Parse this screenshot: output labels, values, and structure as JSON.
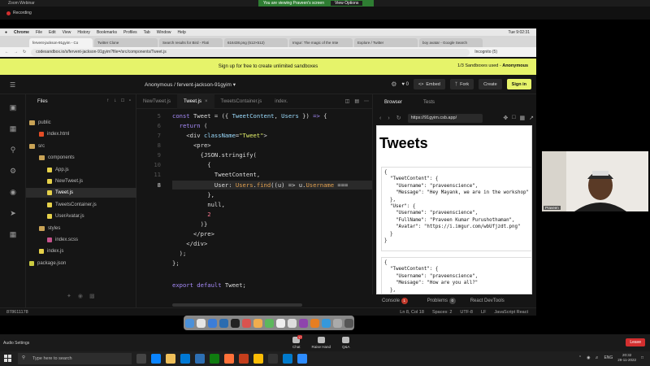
{
  "zoom": {
    "window_title": "Zoom Webinar",
    "banner_text": "You are viewing Praveen's screen",
    "view_options": "View Options",
    "recording": "Recording"
  },
  "mac_menu": {
    "items": [
      "Chrome",
      "File",
      "Edit",
      "View",
      "History",
      "Bookmarks",
      "Profiles",
      "Tab",
      "Window",
      "Help"
    ],
    "clock": "Tue 9:02:31"
  },
  "browser_tabs": [
    {
      "label": "fervent-jackson-91gyim - Co",
      "active": true
    },
    {
      "label": "Twitter Clone",
      "active": false
    },
    {
      "label": "Search results for Bird - Flati",
      "active": false
    },
    {
      "label": "616438.png (512×512)",
      "active": false
    },
    {
      "label": "Imgur: The magic of the Inte",
      "active": false
    },
    {
      "label": "Explore / Twitter",
      "active": false
    },
    {
      "label": "boy avatar - Google Search",
      "active": false
    }
  ],
  "address_bar": {
    "url": "codesandbox.io/s/fervent-jackson-91gyim?file=/src/components/Tweet.js",
    "profile": "Incognito (5)"
  },
  "signup_banner": {
    "text": "Sign up for free to create unlimited sandboxes",
    "sandboxes_prefix": "1/3 Sandboxes used - ",
    "sandboxes_user": "Anonymous"
  },
  "codesandbox_header": {
    "owner": "Anonymous",
    "separator": "/",
    "project": "fervent-jackson-91gyim",
    "like_count": "0",
    "embed": "Embed",
    "fork": "Fork",
    "create": "Create",
    "signin": "Sign in"
  },
  "explorer": {
    "title": "Files",
    "items": [
      {
        "label": "public",
        "type": "folder",
        "depth": 0
      },
      {
        "label": "index.html",
        "type": "html",
        "depth": 1
      },
      {
        "label": "src",
        "type": "folder",
        "depth": 0
      },
      {
        "label": "components",
        "type": "folder",
        "depth": 1
      },
      {
        "label": "App.js",
        "type": "js",
        "depth": 2
      },
      {
        "label": "NewTweet.js",
        "type": "js",
        "depth": 2
      },
      {
        "label": "Tweet.js",
        "type": "js",
        "depth": 2,
        "selected": true
      },
      {
        "label": "TweetsContainer.js",
        "type": "js",
        "depth": 2
      },
      {
        "label": "UserAvatar.js",
        "type": "js",
        "depth": 2
      },
      {
        "label": "styles",
        "type": "folder",
        "depth": 1
      },
      {
        "label": "index.scss",
        "type": "scss",
        "depth": 2
      },
      {
        "label": "index.js",
        "type": "js",
        "depth": 1
      },
      {
        "label": "package.json",
        "type": "json",
        "depth": 0
      }
    ]
  },
  "editor_tabs": [
    {
      "label": "NewTweet.js",
      "active": false
    },
    {
      "label": "Tweet.js",
      "active": true
    },
    {
      "label": "TweetsContainer.js",
      "active": false
    },
    {
      "label": "index.",
      "active": false
    }
  ],
  "code_lines": [
    {
      "num": "5",
      "text": "const Tweet = ({ TweetContent, Users }) => {"
    },
    {
      "num": "6",
      "text": "  return ("
    },
    {
      "num": "7",
      "text": "    <div className=\"Tweet\">"
    },
    {
      "num": "8",
      "text": "      <pre>"
    },
    {
      "num": "9",
      "text": "        {JSON.stringify("
    },
    {
      "num": "10",
      "text": "          {"
    },
    {
      "num": "11",
      "text": "            TweetContent,"
    },
    {
      "num": "8",
      "text": "            User: Users.find((u) => u.Username ==="
    },
    {
      "num": "",
      "text": "          },"
    },
    {
      "num": "",
      "text": "          null,"
    },
    {
      "num": "",
      "text": "          2"
    },
    {
      "num": "",
      "text": "        )}"
    },
    {
      "num": "",
      "text": "      </pre>"
    },
    {
      "num": "",
      "text": "    </div>"
    },
    {
      "num": "",
      "text": "  );"
    },
    {
      "num": "",
      "text": "};"
    },
    {
      "num": "",
      "text": ""
    },
    {
      "num": "",
      "text": "export default Tweet;"
    }
  ],
  "preview": {
    "tab_browser": "Browser",
    "tab_tests": "Tests",
    "url": "https://91gyim.csb.app/",
    "heading": "Tweets",
    "card1": "{\n  \"TweetContent\": {\n    \"Username\": \"praveenscience\",\n    \"Message\": \"Hey Mayank, we are in the workshop\"\n  },\n  \"User\": {\n    \"Username\": \"praveenscience\",\n    \"FullName\": \"Praveen Kumar Purushothaman\",\n    \"Avatar\": \"https://i.imgur.com/wbUfjzdt.png\"\n  }\n}",
    "card2": "{\n  \"TweetContent\": {\n    \"Username\": \"praveenscience\",\n    \"Message\": \"How are you all?\"\n  },"
  },
  "console_bar": {
    "console": "Console",
    "console_count": "1",
    "problems": "Problems",
    "problems_count": "0",
    "react_devtools": "React DevTools"
  },
  "status_bar": {
    "left": "878611178",
    "position": "Ln 8, Col 18",
    "spaces": "Spaces: 2",
    "encoding": "UTF-8",
    "eol": "LF",
    "language": "JavaScript React"
  },
  "video": {
    "name": "Praveen"
  },
  "zoom_controls": {
    "audio_settings": "Audio Settings",
    "chat": "Chat",
    "chat_count": "17",
    "raise_hand": "Raise Hand",
    "qa": "Q&A",
    "leave": "Leave"
  },
  "taskbar": {
    "search_placeholder": "Type here to search",
    "lang": "ENG",
    "time": "20:32",
    "date": "29-11-2022"
  },
  "colors": {
    "accent_yellow": "#e6f36a",
    "zoom_green": "#2e7d32",
    "leave_red": "#d32f2f"
  }
}
